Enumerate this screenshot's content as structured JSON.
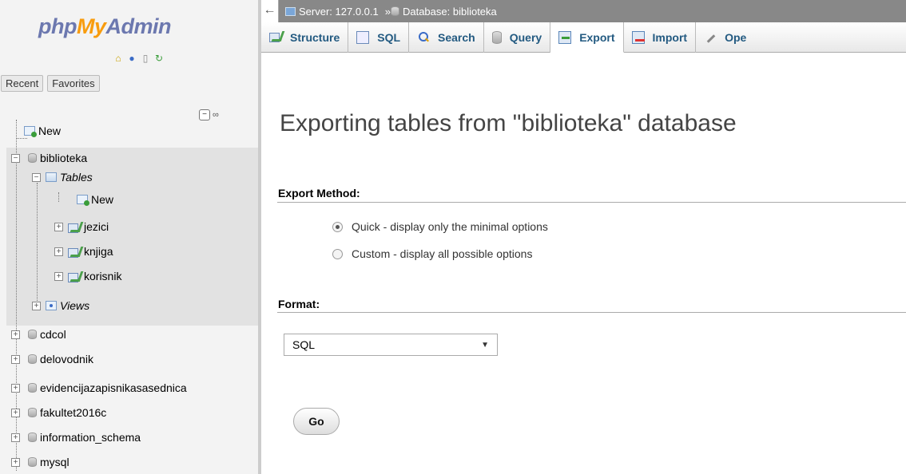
{
  "logo": {
    "php": "php",
    "my": "My",
    "admin": "Admin"
  },
  "nav_icons": [
    "home-icon",
    "help-icon",
    "docs-icon",
    "settings-icon"
  ],
  "nav_tabs": {
    "recent": "Recent",
    "favorites": "Favorites"
  },
  "tree": {
    "new": "New",
    "db_active": "biblioteka",
    "tables": "Tables",
    "tables_new": "New",
    "table_items": [
      "jezici",
      "knjiga",
      "korisnik"
    ],
    "views": "Views",
    "other_dbs": [
      "cdcol",
      "delovodnik",
      "evidencijazapisnikasasednica",
      "fakultet2016c",
      "information_schema",
      "mysql"
    ]
  },
  "breadcrumb": {
    "server": "Server: 127.0.0.1",
    "sep": "»",
    "database": "Database: biblioteka"
  },
  "menu": {
    "structure": "Structure",
    "sql": "SQL",
    "search": "Search",
    "query": "Query",
    "export": "Export",
    "import": "Import",
    "operations": "Ope"
  },
  "main": {
    "title": "Exporting tables from \"biblioteka\" database",
    "export_method_label": "Export Method:",
    "radio_quick": "Quick - display only the minimal options",
    "radio_custom": "Custom - display all possible options",
    "format_label": "Format:",
    "format_value": "SQL",
    "go_label": "Go"
  }
}
